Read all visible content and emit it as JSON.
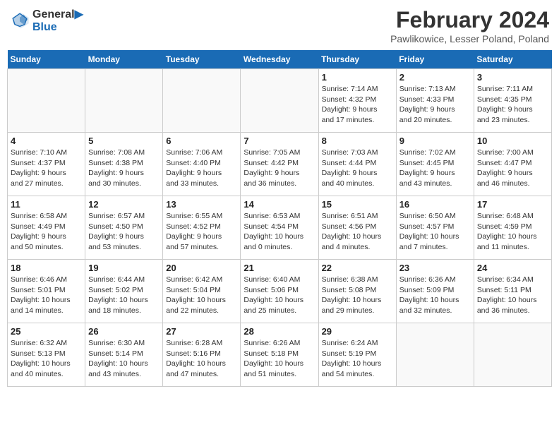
{
  "header": {
    "logo_line1": "General",
    "logo_line2": "Blue",
    "title": "February 2024",
    "subtitle": "Pawlikowice, Lesser Poland, Poland"
  },
  "calendar": {
    "headers": [
      "Sunday",
      "Monday",
      "Tuesday",
      "Wednesday",
      "Thursday",
      "Friday",
      "Saturday"
    ],
    "weeks": [
      [
        {
          "day": "",
          "info": ""
        },
        {
          "day": "",
          "info": ""
        },
        {
          "day": "",
          "info": ""
        },
        {
          "day": "",
          "info": ""
        },
        {
          "day": "1",
          "info": "Sunrise: 7:14 AM\nSunset: 4:32 PM\nDaylight: 9 hours\nand 17 minutes."
        },
        {
          "day": "2",
          "info": "Sunrise: 7:13 AM\nSunset: 4:33 PM\nDaylight: 9 hours\nand 20 minutes."
        },
        {
          "day": "3",
          "info": "Sunrise: 7:11 AM\nSunset: 4:35 PM\nDaylight: 9 hours\nand 23 minutes."
        }
      ],
      [
        {
          "day": "4",
          "info": "Sunrise: 7:10 AM\nSunset: 4:37 PM\nDaylight: 9 hours\nand 27 minutes."
        },
        {
          "day": "5",
          "info": "Sunrise: 7:08 AM\nSunset: 4:38 PM\nDaylight: 9 hours\nand 30 minutes."
        },
        {
          "day": "6",
          "info": "Sunrise: 7:06 AM\nSunset: 4:40 PM\nDaylight: 9 hours\nand 33 minutes."
        },
        {
          "day": "7",
          "info": "Sunrise: 7:05 AM\nSunset: 4:42 PM\nDaylight: 9 hours\nand 36 minutes."
        },
        {
          "day": "8",
          "info": "Sunrise: 7:03 AM\nSunset: 4:44 PM\nDaylight: 9 hours\nand 40 minutes."
        },
        {
          "day": "9",
          "info": "Sunrise: 7:02 AM\nSunset: 4:45 PM\nDaylight: 9 hours\nand 43 minutes."
        },
        {
          "day": "10",
          "info": "Sunrise: 7:00 AM\nSunset: 4:47 PM\nDaylight: 9 hours\nand 46 minutes."
        }
      ],
      [
        {
          "day": "11",
          "info": "Sunrise: 6:58 AM\nSunset: 4:49 PM\nDaylight: 9 hours\nand 50 minutes."
        },
        {
          "day": "12",
          "info": "Sunrise: 6:57 AM\nSunset: 4:50 PM\nDaylight: 9 hours\nand 53 minutes."
        },
        {
          "day": "13",
          "info": "Sunrise: 6:55 AM\nSunset: 4:52 PM\nDaylight: 9 hours\nand 57 minutes."
        },
        {
          "day": "14",
          "info": "Sunrise: 6:53 AM\nSunset: 4:54 PM\nDaylight: 10 hours\nand 0 minutes."
        },
        {
          "day": "15",
          "info": "Sunrise: 6:51 AM\nSunset: 4:56 PM\nDaylight: 10 hours\nand 4 minutes."
        },
        {
          "day": "16",
          "info": "Sunrise: 6:50 AM\nSunset: 4:57 PM\nDaylight: 10 hours\nand 7 minutes."
        },
        {
          "day": "17",
          "info": "Sunrise: 6:48 AM\nSunset: 4:59 PM\nDaylight: 10 hours\nand 11 minutes."
        }
      ],
      [
        {
          "day": "18",
          "info": "Sunrise: 6:46 AM\nSunset: 5:01 PM\nDaylight: 10 hours\nand 14 minutes."
        },
        {
          "day": "19",
          "info": "Sunrise: 6:44 AM\nSunset: 5:02 PM\nDaylight: 10 hours\nand 18 minutes."
        },
        {
          "day": "20",
          "info": "Sunrise: 6:42 AM\nSunset: 5:04 PM\nDaylight: 10 hours\nand 22 minutes."
        },
        {
          "day": "21",
          "info": "Sunrise: 6:40 AM\nSunset: 5:06 PM\nDaylight: 10 hours\nand 25 minutes."
        },
        {
          "day": "22",
          "info": "Sunrise: 6:38 AM\nSunset: 5:08 PM\nDaylight: 10 hours\nand 29 minutes."
        },
        {
          "day": "23",
          "info": "Sunrise: 6:36 AM\nSunset: 5:09 PM\nDaylight: 10 hours\nand 32 minutes."
        },
        {
          "day": "24",
          "info": "Sunrise: 6:34 AM\nSunset: 5:11 PM\nDaylight: 10 hours\nand 36 minutes."
        }
      ],
      [
        {
          "day": "25",
          "info": "Sunrise: 6:32 AM\nSunset: 5:13 PM\nDaylight: 10 hours\nand 40 minutes."
        },
        {
          "day": "26",
          "info": "Sunrise: 6:30 AM\nSunset: 5:14 PM\nDaylight: 10 hours\nand 43 minutes."
        },
        {
          "day": "27",
          "info": "Sunrise: 6:28 AM\nSunset: 5:16 PM\nDaylight: 10 hours\nand 47 minutes."
        },
        {
          "day": "28",
          "info": "Sunrise: 6:26 AM\nSunset: 5:18 PM\nDaylight: 10 hours\nand 51 minutes."
        },
        {
          "day": "29",
          "info": "Sunrise: 6:24 AM\nSunset: 5:19 PM\nDaylight: 10 hours\nand 54 minutes."
        },
        {
          "day": "",
          "info": ""
        },
        {
          "day": "",
          "info": ""
        }
      ]
    ]
  }
}
